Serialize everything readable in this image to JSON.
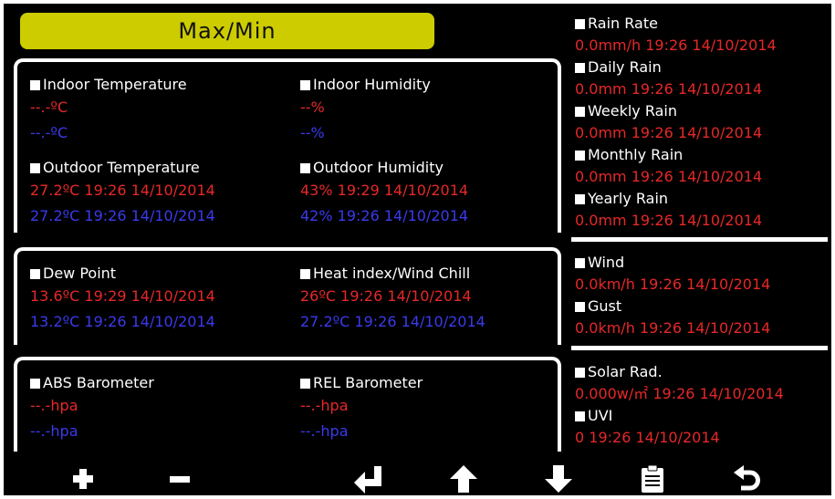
{
  "title": "Max/Min",
  "indoor_temperature": {
    "label": "Indoor Temperature",
    "max": "--.-ºC",
    "min": "--.-ºC"
  },
  "indoor_humidity": {
    "label": "Indoor Humidity",
    "max": "--%",
    "min": "--%"
  },
  "outdoor_temperature": {
    "label": "Outdoor Temperature",
    "max": "27.2ºC 19:26 14/10/2014",
    "min": "27.2ºC 19:26 14/10/2014"
  },
  "outdoor_humidity": {
    "label": "Outdoor Humidity",
    "max": "43% 19:29 14/10/2014",
    "min": "42% 19:26 14/10/2014"
  },
  "dew_point": {
    "label": "Dew Point",
    "max": "13.6ºC 19:29 14/10/2014",
    "min": "13.2ºC 19:26 14/10/2014"
  },
  "heat_index": {
    "label": "Heat index/Wind Chill",
    "max": "26ºC 19:26 14/10/2014",
    "min": "27.2ºC 19:26 14/10/2014"
  },
  "abs_barometer": {
    "label": "ABS Barometer",
    "max": "--.-hpa",
    "min": "--.-hpa"
  },
  "rel_barometer": {
    "label": "REL Barometer",
    "max": "--.-hpa",
    "min": "--.-hpa"
  },
  "rain_rate": {
    "label": "Rain Rate",
    "max": "0.0mm/h 19:26 14/10/2014"
  },
  "daily_rain": {
    "label": "Daily Rain",
    "max": "0.0mm 19:26 14/10/2014"
  },
  "weekly_rain": {
    "label": "Weekly Rain",
    "max": "0.0mm 19:26 14/10/2014"
  },
  "monthly_rain": {
    "label": "Monthly Rain",
    "max": "0.0mm 19:26 14/10/2014"
  },
  "yearly_rain": {
    "label": "Yearly Rain",
    "max": "0.0mm 19:26 14/10/2014"
  },
  "wind": {
    "label": "Wind",
    "max": "0.0km/h 19:26 14/10/2014"
  },
  "gust": {
    "label": "Gust",
    "max": "0.0km/h 19:26 14/10/2014"
  },
  "solar_rad": {
    "label": "Solar Rad.",
    "max": "0.000w/㎡ 19:26 14/10/2014"
  },
  "uvi": {
    "label": "UVI",
    "max": "0 19:26 14/10/2014"
  },
  "toolbar": {
    "plus_icon": "plus-icon",
    "minus_icon": "minus-icon",
    "enter_icon": "enter-arrow-icon",
    "up_icon": "arrow-up-icon",
    "down_icon": "arrow-down-icon",
    "clipboard_icon": "clipboard-icon",
    "back_icon": "back-arrow-icon"
  },
  "colors": {
    "background": "#000000",
    "title_bar": "#cccc00",
    "max_value": "#e62828",
    "min_value": "#3a3aee",
    "label": "#ffffff"
  }
}
